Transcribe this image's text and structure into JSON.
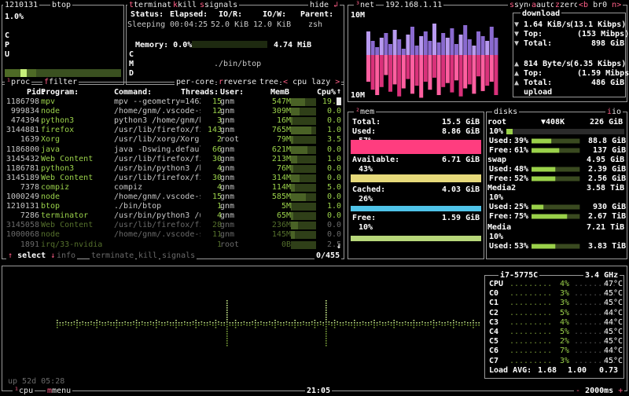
{
  "mini_cpu": {
    "title": "1210131",
    "menu": "btop",
    "percent": "1.0%",
    "letters": [
      "C",
      "P",
      "U"
    ]
  },
  "detail": {
    "label_terminate": "terminate",
    "label_kill": "kill",
    "label_signals": "signals",
    "label_hide": "hide",
    "col_status": "Status:",
    "col_elapsed": "Elapsed:",
    "col_ior": "IO/R:",
    "col_iow": "IO/W:",
    "col_parent": "Parent:",
    "status": "Sleeping",
    "elapsed": "00:04:25",
    "ior": "52.0 KiB",
    "iow": "12.0 KiB",
    "parent": "zsh",
    "memory_label": "Memory: 0.0%",
    "memory_value": "4.74 MiB",
    "memory_fraction": 0.0,
    "cmd_letters": [
      "C",
      "M",
      "D"
    ],
    "cmd": "./bin/btop"
  },
  "proc": {
    "tab": "proc",
    "filter": "filter",
    "per_core": "per-core",
    "reverse": "reverse",
    "tree": "tree",
    "sort": "cpu lazy",
    "headers": {
      "pid": "Pid:",
      "program": "Program:",
      "command": "Command:",
      "threads": "Threads:",
      "user": "User:",
      "mem": "MemB",
      "cpu": "Cpu%"
    },
    "rows": [
      {
        "pid": "1186798",
        "program": "mpv",
        "command": "mpv --geometry=1462",
        "threads": "15",
        "user": "gnm",
        "mem": "547M",
        "cpu": "19.5",
        "memfrac": 0.55,
        "cpufrac": 0.9
      },
      {
        "pid": "999834",
        "program": "node",
        "command": "/home/gnm/.vscode-s",
        "threads": "12",
        "user": "gnm",
        "mem": "309M",
        "cpu": "0.0",
        "memfrac": 0.35,
        "cpufrac": 0
      },
      {
        "pid": "474394",
        "program": "python3",
        "command": "python3 /home/gnm/b",
        "threads": "3",
        "user": "gnm",
        "mem": "16M",
        "cpu": "0.0",
        "memfrac": 0.05,
        "cpufrac": 0
      },
      {
        "pid": "3144881",
        "program": "firefox",
        "command": "/usr/lib/firefox/fi",
        "threads": "143",
        "user": "gnm",
        "mem": "765M",
        "cpu": "1.0",
        "memfrac": 0.8,
        "cpufrac": 0.1
      },
      {
        "pid": "1639",
        "program": "Xorg",
        "command": "/usr/lib/xorg/Xorg",
        "threads": "2",
        "user": "root",
        "mem": "79M",
        "cpu": "3.5",
        "memfrac": 0.1,
        "cpufrac": 0.2
      },
      {
        "pid": "1186800",
        "program": "java",
        "command": "java -Dswing.defaul",
        "threads": "66",
        "user": "gnm",
        "mem": "621M",
        "cpu": "0.0",
        "memfrac": 0.65,
        "cpufrac": 0
      },
      {
        "pid": "3145432",
        "program": "Web Content",
        "command": "/usr/lib/firefox/fi",
        "threads": "30",
        "user": "gnm",
        "mem": "213M",
        "cpu": "1.0",
        "memfrac": 0.25,
        "cpufrac": 0.1
      },
      {
        "pid": "1186781",
        "program": "python3",
        "command": "/usr/bin/python3 /h",
        "threads": "4",
        "user": "gnm",
        "mem": "76M",
        "cpu": "0.0",
        "memfrac": 0.1,
        "cpufrac": 0
      },
      {
        "pid": "3145189",
        "program": "Web Content",
        "command": "/usr/lib/firefox/fi",
        "threads": "30",
        "user": "gnm",
        "mem": "314M",
        "cpu": "0.0",
        "memfrac": 0.35,
        "cpufrac": 0
      },
      {
        "pid": "7378",
        "program": "compiz",
        "command": "compiz",
        "threads": "4",
        "user": "gnm",
        "mem": "114M",
        "cpu": "5.0",
        "memfrac": 0.15,
        "cpufrac": 0.3
      },
      {
        "pid": "1000249",
        "program": "node",
        "command": "/home/gnm/.vscode-s",
        "threads": "15",
        "user": "gnm",
        "mem": "585M",
        "cpu": "0.0",
        "memfrac": 0.6,
        "cpufrac": 0
      },
      {
        "pid": "1210131",
        "program": "btop",
        "command": "./bin/btop",
        "threads": "1",
        "user": "gnm",
        "mem": "5M",
        "cpu": "1.0",
        "memfrac": 0.03,
        "cpufrac": 0.1
      },
      {
        "pid": "7286",
        "program": "terminator",
        "command": "/usr/bin/python3 /u",
        "threads": "4",
        "user": "gnm",
        "mem": "65M",
        "cpu": "0.0",
        "memfrac": 0.08,
        "cpufrac": 0
      },
      {
        "pid": "3145058",
        "program": "Web Content",
        "command": "/usr/lib/firefox/fi",
        "threads": "28",
        "user": "gnm",
        "mem": "236M",
        "cpu": "0.0",
        "memfrac": 0.28,
        "cpufrac": 0
      },
      {
        "pid": "1000068",
        "program": "node",
        "command": "/home/gnm/.vscode-s",
        "threads": "11",
        "user": "gnm",
        "mem": "145M",
        "cpu": "0.0",
        "memfrac": 0.17,
        "cpufrac": 0
      },
      {
        "pid": "1891",
        "program": "irq/33-nvidia",
        "command": "",
        "threads": "1",
        "user": "root",
        "mem": "0B",
        "cpu": "2.5",
        "memfrac": 0,
        "cpufrac": 0.15
      }
    ],
    "footer": {
      "select": "select",
      "info": "info",
      "terminate": "terminate",
      "kill": "kill",
      "signals": "signals",
      "count": "0/455"
    }
  },
  "net": {
    "title": "net",
    "address": "192.168.1.11",
    "sync": "sync",
    "auto": "auto",
    "zero": "zero",
    "iface": "br0",
    "scale_top": "10M",
    "scale_bottom": "10M",
    "download_label": "download",
    "dl_rate": "1.64 KiB/s",
    "dl_bits": "(13.1 Kibps)",
    "dl_top_label": "Top:",
    "dl_top": "(153 Mibps)",
    "dl_total_label": "Total:",
    "dl_total": "898 GiB",
    "upload_label": "upload",
    "ul_rate": "814 Byte/s",
    "ul_bits": "(6.35 Kibps)",
    "ul_top_label": "Top:",
    "ul_top": "(1.59 Mibps)",
    "ul_total_label": "Total:",
    "ul_total": "486 GiB"
  },
  "mem": {
    "title": "mem",
    "total_label": "Total:",
    "total": "15.5 GiB",
    "used_label": "Used:",
    "used": "8.86 GiB",
    "used_pct": "57%",
    "used_frac": 0.57,
    "avail_label": "Available:",
    "avail": "6.71 GiB",
    "avail_pct": "43%",
    "avail_frac": 0.43,
    "cached_label": "Cached:",
    "cached": "4.03 GiB",
    "cached_pct": "26%",
    "cached_frac": 0.26,
    "free_label": "Free:",
    "free": "1.59 GiB",
    "free_pct": "10%",
    "free_frac": 0.1
  },
  "disks": {
    "title": "disks",
    "io": "io",
    "root": {
      "name": "root",
      "rate": "▼408K",
      "size": "226 GiB",
      "pct": "10%",
      "used_label": "Used:",
      "used_pct": "39%",
      "used": "88.8 GiB",
      "free_label": "Free:",
      "free_pct": "61%",
      "free": "137 GiB",
      "used_frac": 0.39,
      "free_frac": 0.61
    },
    "swap": {
      "name": "swap",
      "size": "4.95 GiB",
      "used_label": "Used:",
      "used_pct": "48%",
      "used": "2.39 GiB",
      "free_label": "Free:",
      "free_pct": "52%",
      "free": "2.56 GiB",
      "used_frac": 0.48,
      "free_frac": 0.52
    },
    "media2": {
      "name": "Media2",
      "size": "3.58 TiB",
      "pct": "10%",
      "used_label": "Used:",
      "used_pct": "25%",
      "used": "930 GiB",
      "free_label": "Free:",
      "free_pct": "75%",
      "free": "2.67 TiB",
      "used_frac": 0.25,
      "free_frac": 0.75
    },
    "media": {
      "name": "Media",
      "size": "7.21 TiB",
      "pct": "10%",
      "used_label": "Used:",
      "used_pct": "53%",
      "used": "3.83 TiB",
      "used_frac": 0.53
    }
  },
  "cpu": {
    "uptime": "up 52d 05:28",
    "tab": "cpu",
    "menu": "menu",
    "clock": "21:05",
    "interval": "2000ms",
    "model": "i7-5775C",
    "freq": "3.4 GHz",
    "cores": [
      {
        "name": "CPU",
        "pct": "4%",
        "temp": "47°C",
        "frac": 0.04
      },
      {
        "name": "C0",
        "pct": "3%",
        "temp": "45°C",
        "frac": 0.03
      },
      {
        "name": "C1",
        "pct": "3%",
        "temp": "45°C",
        "frac": 0.03
      },
      {
        "name": "C2",
        "pct": "5%",
        "temp": "44°C",
        "frac": 0.05
      },
      {
        "name": "C3",
        "pct": "4%",
        "temp": "44°C",
        "frac": 0.04
      },
      {
        "name": "C4",
        "pct": "5%",
        "temp": "45°C",
        "frac": 0.05
      },
      {
        "name": "C5",
        "pct": "2%",
        "temp": "45°C",
        "frac": 0.02
      },
      {
        "name": "C6",
        "pct": "7%",
        "temp": "44°C",
        "frac": 0.07
      },
      {
        "name": "C7",
        "pct": "3%",
        "temp": "45°C",
        "frac": 0.03
      }
    ],
    "load_label": "Load AVG:",
    "load1": "1.68",
    "load5": "1.00",
    "load15": "0.73"
  },
  "colors": {
    "accent": "#ff5f87",
    "green": "#9ad14a",
    "border": "#9a9a9a",
    "used": "#ff3d7f",
    "avail": "#e6d97a",
    "cached": "#4fc3e8",
    "free": "#b7d77a"
  }
}
